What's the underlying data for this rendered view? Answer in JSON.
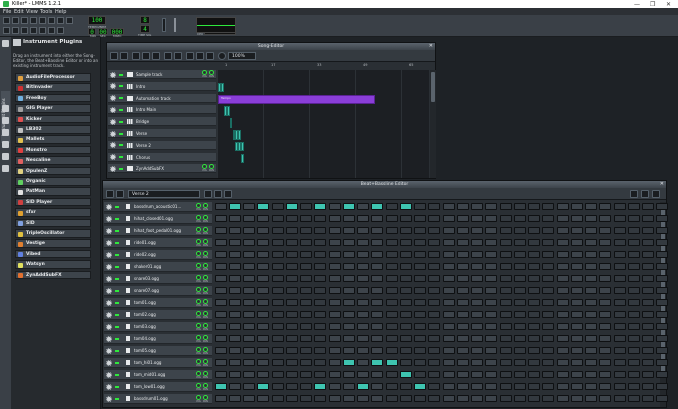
{
  "window": {
    "title": "Killer* - LMMS 1.2.1",
    "controls": [
      "—",
      "❐",
      "✕"
    ]
  },
  "menu": [
    "File",
    "Edit",
    "View",
    "Tools",
    "Help"
  ],
  "toolbar": {
    "tempo_value": "100",
    "tempo_label": "TEMPO/BPM",
    "time": {
      "min": "0",
      "sec": "00",
      "msec": "000"
    },
    "time_labels": {
      "min": "MIN",
      "sec": "SEC",
      "msec": "MSEC"
    },
    "timesig_top": "8",
    "timesig_bottom": "4",
    "timesig_label": "TIME SIG",
    "cpu_label": "CPU"
  },
  "sidebar": {
    "vertical_tab": "Instrument Plugins"
  },
  "plugins": {
    "title": "Instrument Plugins",
    "description": "Drag an instrument into either the Song-Editor, the Beat+Bassline Editor or into an existing instrument track.",
    "items": [
      {
        "name": "AudioFileProcessor",
        "color": "#e0a040"
      },
      {
        "name": "BitInvader",
        "color": "#d03030"
      },
      {
        "name": "FreeBoy",
        "color": "#70b0e0"
      },
      {
        "name": "GIG Player",
        "color": "#a0a0a0"
      },
      {
        "name": "Kicker",
        "color": "#e05050"
      },
      {
        "name": "LB302",
        "color": "#c0c0c0"
      },
      {
        "name": "Mallets",
        "color": "#e0c050"
      },
      {
        "name": "Monstro",
        "color": "#e04040"
      },
      {
        "name": "Nescaline",
        "color": "#e06060"
      },
      {
        "name": "OpulenZ",
        "color": "#e0d080"
      },
      {
        "name": "Organic",
        "color": "#60d060"
      },
      {
        "name": "PatMan",
        "color": "#e0e0e0"
      },
      {
        "name": "SID Player",
        "color": "#d04040"
      },
      {
        "name": "sfxr",
        "color": "#e0a030"
      },
      {
        "name": "SID",
        "color": "#80a0e0"
      },
      {
        "name": "TripleOscillator",
        "color": "#e0c040"
      },
      {
        "name": "Vestige",
        "color": "#e08030"
      },
      {
        "name": "Vibed",
        "color": "#6080e0"
      },
      {
        "name": "Watsyn",
        "color": "#e0e060"
      },
      {
        "name": "ZynAddSubFX",
        "color": "#e07030"
      }
    ]
  },
  "song_editor": {
    "title": "Song-Editor",
    "zoom": "100%",
    "ruler": [
      "1",
      "17",
      "33",
      "49",
      "65"
    ],
    "tracks": [
      {
        "name": "Sample track",
        "type": "sample"
      },
      {
        "name": "Intro",
        "type": "bb"
      },
      {
        "name": "Automation track",
        "type": "automation"
      },
      {
        "name": "Intro Main",
        "type": "bb"
      },
      {
        "name": "Bridge",
        "type": "bb"
      },
      {
        "name": "Verse",
        "type": "bb"
      },
      {
        "name": "Verse 2",
        "type": "bb"
      },
      {
        "name": "Chorus",
        "type": "bb"
      },
      {
        "name": "ZynAddSubFX",
        "type": "instrument"
      }
    ],
    "automation_clip_label": "Tempo",
    "clips": [
      {
        "track": 1,
        "start": 0,
        "len": 1
      },
      {
        "track": 1,
        "start": 1,
        "len": 1
      },
      {
        "track": 3,
        "start": 2,
        "len": 1
      },
      {
        "track": 3,
        "start": 3,
        "len": 1
      },
      {
        "track": 4,
        "start": 4,
        "len": 1
      },
      {
        "track": 5,
        "start": 5,
        "len": 1
      },
      {
        "track": 5,
        "start": 6,
        "len": 1
      },
      {
        "track": 5,
        "start": 7,
        "len": 1
      },
      {
        "track": 6,
        "start": 6,
        "len": 1
      },
      {
        "track": 6,
        "start": 7,
        "len": 1
      },
      {
        "track": 6,
        "start": 8,
        "len": 1
      },
      {
        "track": 7,
        "start": 8,
        "len": 1
      }
    ],
    "automation_clip": {
      "track": 2,
      "start": 0,
      "len": 28
    },
    "knob_labels": [
      "VOL",
      "PAN"
    ],
    "colors": {
      "clip": "#3ec4b0",
      "automation": "#8a3ed8"
    }
  },
  "bb_editor": {
    "title": "Beat+Bassline Editor",
    "selected_pattern": "Verse 2",
    "knob_labels": [
      "VOL",
      "PAN"
    ],
    "tracks": [
      {
        "name": "bassdrum_acoustic01...",
        "on": [
          1,
          3,
          5,
          7,
          9,
          11,
          13
        ]
      },
      {
        "name": "hihat_closed01.ogg",
        "on": []
      },
      {
        "name": "hihat_foot_pedal01.ogg",
        "on": []
      },
      {
        "name": "ride01.ogg",
        "on": []
      },
      {
        "name": "ride02.ogg",
        "on": []
      },
      {
        "name": "shaker01.ogg",
        "on": []
      },
      {
        "name": "snare03.ogg",
        "on": []
      },
      {
        "name": "snare07.ogg",
        "on": []
      },
      {
        "name": "tom01.ogg",
        "on": []
      },
      {
        "name": "tom02.ogg",
        "on": []
      },
      {
        "name": "tom03.ogg",
        "on": []
      },
      {
        "name": "tom04.ogg",
        "on": []
      },
      {
        "name": "tom05.ogg",
        "on": []
      },
      {
        "name": "tom_hi01.ogg",
        "on": [
          9,
          11,
          12
        ]
      },
      {
        "name": "tom_mid01.ogg",
        "on": [
          13
        ]
      },
      {
        "name": "tom_low01.ogg",
        "on": [
          0,
          3,
          7,
          10,
          14
        ]
      },
      {
        "name": "bassdrum01.ogg",
        "on": []
      }
    ],
    "steps": 32
  }
}
